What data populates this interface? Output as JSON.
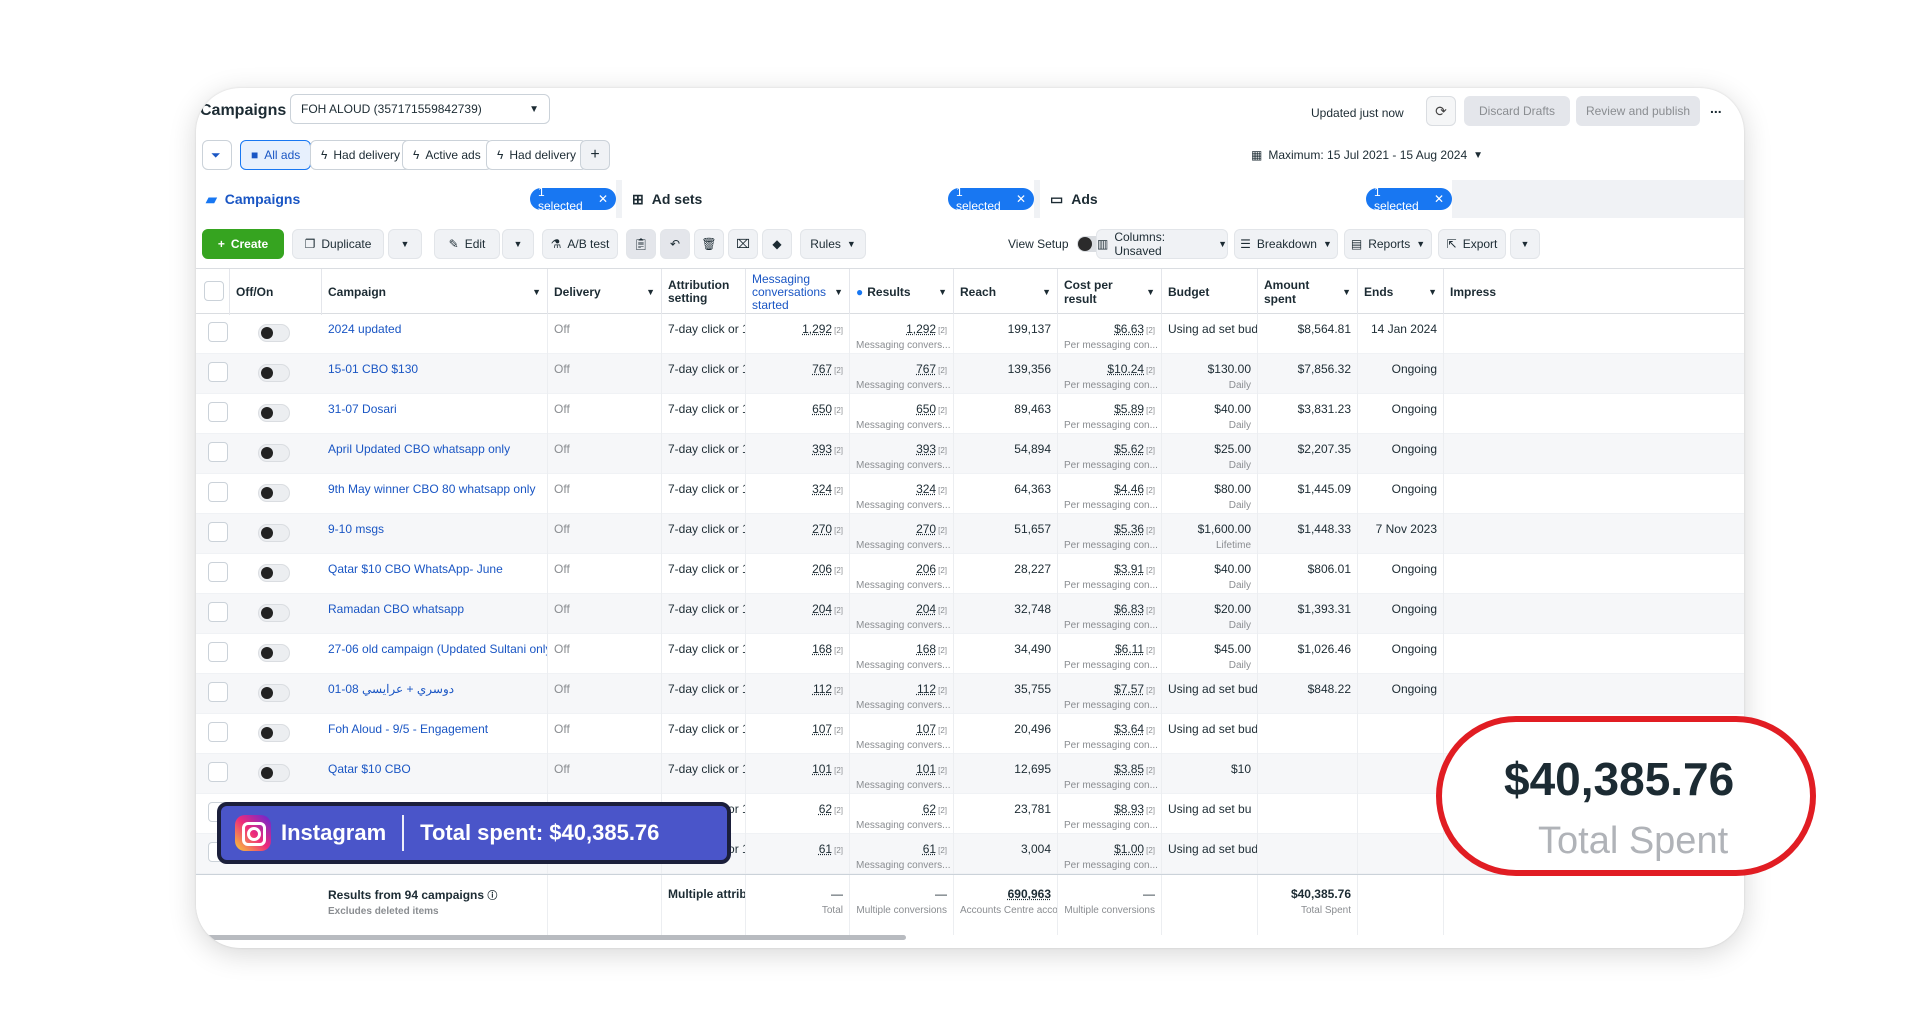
{
  "topbar": {
    "title": "Campaigns",
    "account": "FOH ALOUD (357171559842739)",
    "updated": "Updated just now",
    "discard": "Discard Drafts",
    "review": "Review and publish",
    "more": "..."
  },
  "filters": {
    "all_ads": "All ads",
    "had_delivery_1": "Had delivery",
    "active_ads": "Active ads",
    "had_delivery_2": "Had delivery",
    "add": "+",
    "date_range": "Maximum: 15 Jul 2021 - 15 Aug 2024"
  },
  "levels": {
    "campaigns": "Campaigns",
    "adsets": "Ad sets",
    "ads": "Ads",
    "selected": "1 selected"
  },
  "toolbar": {
    "create": "Create",
    "duplicate": "Duplicate",
    "edit": "Edit",
    "ab_test": "A/B test",
    "rules": "Rules",
    "view_setup": "View Setup",
    "columns": "Columns: Unsaved",
    "breakdown": "Breakdown",
    "reports": "Reports",
    "export": "Export"
  },
  "columns": {
    "offon": "Off/On",
    "campaign": "Campaign",
    "delivery": "Delivery",
    "attribution": "Attribution setting",
    "messaging": "Messaging conversations started",
    "results": "Results",
    "reach": "Reach",
    "cpr": "Cost per result",
    "budget": "Budget",
    "amount_spent": "Amount spent",
    "ends": "Ends",
    "impressions": "Impress"
  },
  "rows": [
    {
      "name": "2024 updated",
      "delivery": "Off",
      "attr": "7-day click or 1...",
      "msg": "1,292",
      "results": "1,292",
      "results_sub": "Messaging convers...",
      "reach": "199,137",
      "cpr": "$6.63",
      "cpr_sub": "Per messaging con...",
      "budget": "Using ad set bud...",
      "budget_sub": "",
      "spent": "$8,564.81",
      "ends": "14 Jan 2024"
    },
    {
      "name": "15-01 CBO $130",
      "delivery": "Off",
      "attr": "7-day click or 1...",
      "msg": "767",
      "results": "767",
      "results_sub": "Messaging convers...",
      "reach": "139,356",
      "cpr": "$10.24",
      "cpr_sub": "Per messaging con...",
      "budget": "$130.00",
      "budget_sub": "Daily",
      "spent": "$7,856.32",
      "ends": "Ongoing"
    },
    {
      "name": "31-07 Dosari",
      "delivery": "Off",
      "attr": "7-day click or 1...",
      "msg": "650",
      "results": "650",
      "results_sub": "Messaging convers...",
      "reach": "89,463",
      "cpr": "$5.89",
      "cpr_sub": "Per messaging con...",
      "budget": "$40.00",
      "budget_sub": "Daily",
      "spent": "$3,831.23",
      "ends": "Ongoing"
    },
    {
      "name": "April Updated CBO whatsapp only",
      "delivery": "Off",
      "attr": "7-day click or 1...",
      "msg": "393",
      "results": "393",
      "results_sub": "Messaging convers...",
      "reach": "54,894",
      "cpr": "$5.62",
      "cpr_sub": "Per messaging con...",
      "budget": "$25.00",
      "budget_sub": "Daily",
      "spent": "$2,207.35",
      "ends": "Ongoing"
    },
    {
      "name": "9th May winner CBO 80 whatsapp only",
      "delivery": "Off",
      "attr": "7-day click or 1...",
      "msg": "324",
      "results": "324",
      "results_sub": "Messaging convers...",
      "reach": "64,363",
      "cpr": "$4.46",
      "cpr_sub": "Per messaging con...",
      "budget": "$80.00",
      "budget_sub": "Daily",
      "spent": "$1,445.09",
      "ends": "Ongoing"
    },
    {
      "name": "9-10 msgs",
      "delivery": "Off",
      "attr": "7-day click or 1...",
      "msg": "270",
      "results": "270",
      "results_sub": "Messaging convers...",
      "reach": "51,657",
      "cpr": "$5.36",
      "cpr_sub": "Per messaging con...",
      "budget": "$1,600.00",
      "budget_sub": "Lifetime",
      "spent": "$1,448.33",
      "ends": "7 Nov 2023"
    },
    {
      "name": "Qatar $10 CBO WhatsApp- June",
      "delivery": "Off",
      "attr": "7-day click or 1...",
      "msg": "206",
      "results": "206",
      "results_sub": "Messaging convers...",
      "reach": "28,227",
      "cpr": "$3.91",
      "cpr_sub": "Per messaging con...",
      "budget": "$40.00",
      "budget_sub": "Daily",
      "spent": "$806.01",
      "ends": "Ongoing"
    },
    {
      "name": "Ramadan CBO whatsapp",
      "delivery": "Off",
      "attr": "7-day click or 1...",
      "msg": "204",
      "results": "204",
      "results_sub": "Messaging convers...",
      "reach": "32,748",
      "cpr": "$6.83",
      "cpr_sub": "Per messaging con...",
      "budget": "$20.00",
      "budget_sub": "Daily",
      "spent": "$1,393.31",
      "ends": "Ongoing"
    },
    {
      "name": "27-06 old campaign (Updated Sultani only)",
      "delivery": "Off",
      "attr": "7-day click or 1...",
      "msg": "168",
      "results": "168",
      "results_sub": "Messaging convers...",
      "reach": "34,490",
      "cpr": "$6.11",
      "cpr_sub": "Per messaging con...",
      "budget": "$45.00",
      "budget_sub": "Daily",
      "spent": "$1,026.46",
      "ends": "Ongoing"
    },
    {
      "name": "01-08 دوسري + عرايسي",
      "delivery": "Off",
      "attr": "7-day click or 1...",
      "msg": "112",
      "results": "112",
      "results_sub": "Messaging convers...",
      "reach": "35,755",
      "cpr": "$7.57",
      "cpr_sub": "Per messaging con...",
      "budget": "Using ad set bud...",
      "budget_sub": "",
      "spent": "$848.22",
      "ends": "Ongoing"
    },
    {
      "name": "Foh Aloud - 9/5 - Engagement",
      "delivery": "Off",
      "attr": "7-day click or 1...",
      "msg": "107",
      "results": "107",
      "results_sub": "Messaging convers...",
      "reach": "20,496",
      "cpr": "$3.64",
      "cpr_sub": "Per messaging con...",
      "budget": "Using ad set bud...",
      "budget_sub": "",
      "spent": "",
      "ends": ""
    },
    {
      "name": "Qatar $10 CBO",
      "delivery": "Off",
      "attr": "7-day click or 1...",
      "msg": "101",
      "results": "101",
      "results_sub": "Messaging convers...",
      "reach": "12,695",
      "cpr": "$3.85",
      "cpr_sub": "Per messaging con...",
      "budget": "$10",
      "budget_sub": "",
      "spent": "",
      "ends": ""
    },
    {
      "name": "",
      "delivery": "",
      "attr": "7-day click or 1...",
      "msg": "62",
      "results": "62",
      "results_sub": "Messaging convers...",
      "reach": "23,781",
      "cpr": "$8.93",
      "cpr_sub": "Per messaging con...",
      "budget": "Using ad set bu",
      "budget_sub": "",
      "spent": "",
      "ends": ""
    },
    {
      "name": "",
      "delivery": "",
      "attr": "7-day click or 1...",
      "msg": "61",
      "results": "61",
      "results_sub": "Messaging convers...",
      "reach": "3,004",
      "cpr": "$1.00",
      "cpr_sub": "Per messaging con...",
      "budget": "Using ad set bud...",
      "budget_sub": "",
      "spent": "",
      "ends": ""
    }
  ],
  "summary": {
    "label": "Results from 94 campaigns",
    "sub": "Excludes deleted items",
    "attr": "Multiple attrib...",
    "msg": "—",
    "msg_sub": "Total",
    "results": "—",
    "results_sub": "Multiple conversions",
    "reach": "690,963",
    "reach_sub": "Accounts Centre acco...",
    "cpr": "—",
    "cpr_sub": "Multiple conversions",
    "spent": "$40,385.76",
    "spent_sub": "Total Spent"
  },
  "banner": {
    "platform": "Instagram",
    "total": "Total spent: $40,385.76"
  },
  "callout": {
    "amount": "$40,385.76",
    "label": "Total Spent"
  }
}
